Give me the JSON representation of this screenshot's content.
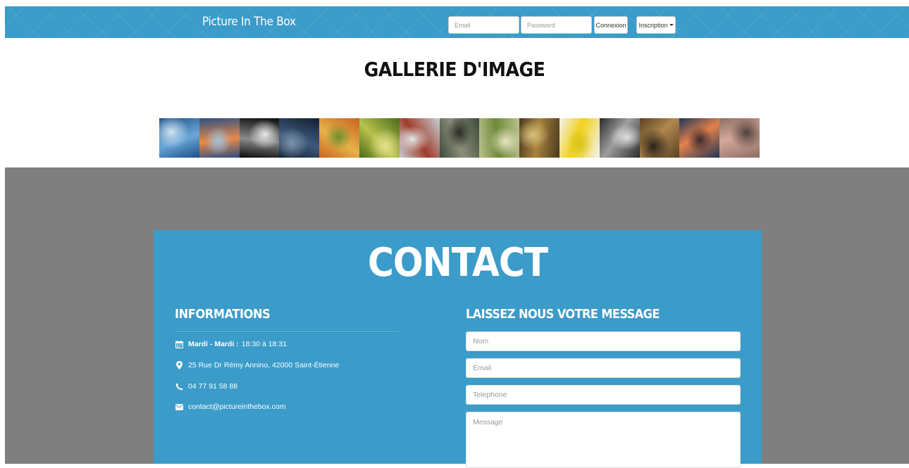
{
  "navbar": {
    "brand": "Picture In The Box",
    "email_placeholder": "Email",
    "password_placeholder": "Password",
    "login_label": "Connexion",
    "signup_label": "Inscription",
    "color": "#3b9bc9"
  },
  "gallery": {
    "title": "GALLERIE D'IMAGE",
    "thumbnails": [
      {
        "name": "lake-reflection-photo",
        "colors": [
          "#1a4f86",
          "#6aa7d8",
          "#cfe3f1"
        ]
      },
      {
        "name": "ice-sunset-photo",
        "colors": [
          "#2b4f82",
          "#e88a4a",
          "#9ac2e0"
        ]
      },
      {
        "name": "bw-bench-photo",
        "colors": [
          "#0c0c0c",
          "#8a8a8a",
          "#e8e8e8"
        ]
      },
      {
        "name": "dark-seascape-photo",
        "colors": [
          "#13202f",
          "#3c5a7c",
          "#7d93ac"
        ]
      },
      {
        "name": "autumn-blur-photo",
        "colors": [
          "#c8621f",
          "#e6b34a",
          "#6d8d2c"
        ]
      },
      {
        "name": "forest-light-photo",
        "colors": [
          "#4d6a19",
          "#b7c24d",
          "#e6e08a"
        ]
      },
      {
        "name": "golden-gate-fog-photo",
        "colors": [
          "#c7cfd3",
          "#a03d2b",
          "#e3e7ea"
        ]
      },
      {
        "name": "birds-branch-photo",
        "colors": [
          "#3e4a3a",
          "#8c8f7a",
          "#2a2a24"
        ]
      },
      {
        "name": "hummingbird-photo",
        "colors": [
          "#b9c08c",
          "#6f8a3a",
          "#e7e3c0"
        ]
      },
      {
        "name": "autumn-trees-photo",
        "colors": [
          "#4a3a1f",
          "#a8833d",
          "#d9c27a"
        ]
      },
      {
        "name": "yellow-flower-photo",
        "colors": [
          "#f2f2ef",
          "#f2d21b",
          "#d8c21a"
        ]
      },
      {
        "name": "bw-street-photo",
        "colors": [
          "#2c2c2c",
          "#9e9e9e",
          "#e0e0e0"
        ]
      },
      {
        "name": "field-sunlight-photo",
        "colors": [
          "#5b4326",
          "#b0874d",
          "#2a2318"
        ]
      },
      {
        "name": "pier-sunset-photo",
        "colors": [
          "#1f3558",
          "#e4814b",
          "#3c2a2f"
        ]
      },
      {
        "name": "canal-city-photo",
        "colors": [
          "#8e6d62",
          "#d4a89c",
          "#4d3f3a"
        ]
      }
    ]
  },
  "contact": {
    "title": "CONTACT",
    "info_heading": "INFORMATIONS",
    "hours_label": "Mardi - Mardi :",
    "hours_value": "18:30 à 18:31",
    "address": "25 Rue Dr Rémy Annino, 42000 Saint-Étienne",
    "phone": "04 77 91 58 88",
    "email": "contact@pictureinthebox.com",
    "message_heading": "LAISSEZ NOUS VOTRE MESSAGE",
    "name_placeholder": "Nom",
    "email_placeholder": "Email",
    "phone_placeholder": "Telephone",
    "message_placeholder": "Message",
    "panel_color": "#3b9bc9",
    "band_color": "#7f7f7f"
  }
}
